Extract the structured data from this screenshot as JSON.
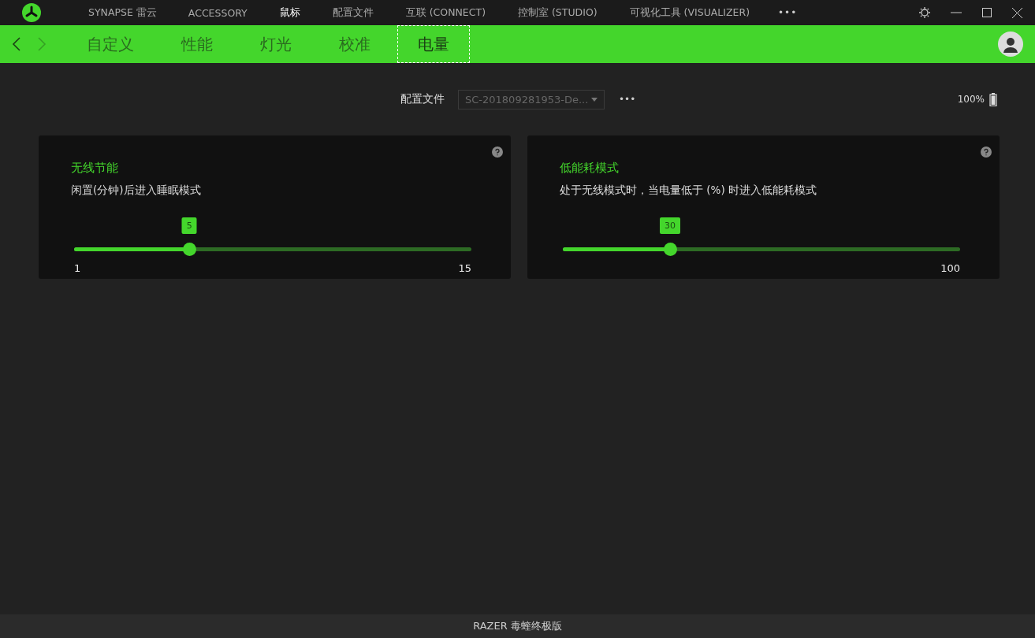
{
  "top_nav": [
    {
      "label": "SYNAPSE 雷云",
      "selected": false
    },
    {
      "label": "ACCESSORY",
      "selected": false
    },
    {
      "label": "鼠标",
      "selected": true
    },
    {
      "label": "配置文件",
      "selected": false
    },
    {
      "label": "互联 (CONNECT)",
      "selected": false
    },
    {
      "label": "控制室 (STUDIO)",
      "selected": false
    },
    {
      "label": "可视化工具 (VISUALIZER)",
      "selected": false
    }
  ],
  "more_label": "•••",
  "sub_tabs": [
    {
      "label": "自定义",
      "selected": false
    },
    {
      "label": "性能",
      "selected": false
    },
    {
      "label": "灯光",
      "selected": false
    },
    {
      "label": "校准",
      "selected": false
    },
    {
      "label": "电量",
      "selected": true
    }
  ],
  "profile": {
    "label": "配置文件",
    "value": "SC-201809281953-De...",
    "more": "•••"
  },
  "battery": {
    "reading": "100%"
  },
  "cards": [
    {
      "title": "无线节能",
      "description": "闲置(分钟)后进入睡眠模式",
      "slider": {
        "level": 0.29,
        "value": "5",
        "min_label": "1",
        "max_label": "15"
      }
    },
    {
      "title": "低能耗模式",
      "description": "处于无线模式时，当电量低于 (%) 时进入低能耗模式",
      "slider": {
        "level": 0.27,
        "value": "30",
        "max_label": "100"
      }
    }
  ],
  "footer": "RAZER 毒蝰终极版"
}
